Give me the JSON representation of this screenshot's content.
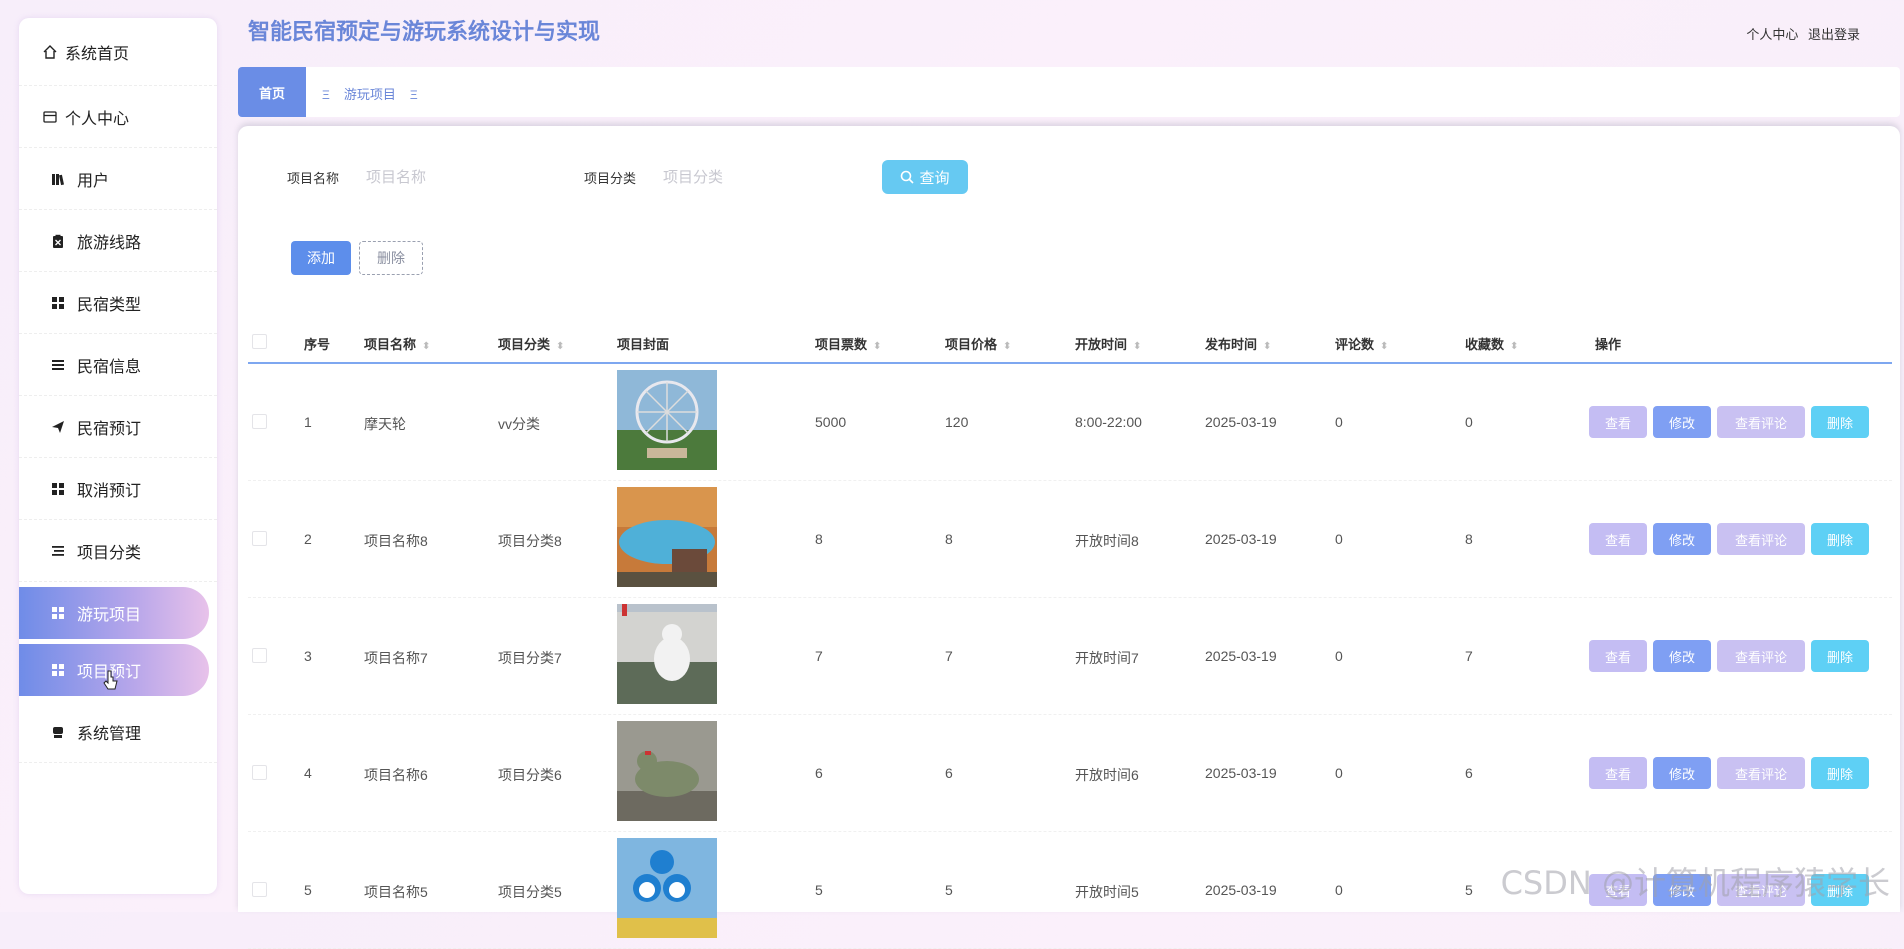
{
  "app_title": "智能民宿预定与游玩系统设计与实现",
  "header": {
    "profile": "个人中心",
    "logout": "退出登录"
  },
  "sidebar": {
    "items": [
      {
        "label": "系统首页",
        "icon": "home-icon"
      },
      {
        "label": "个人中心",
        "icon": "card-icon"
      },
      {
        "label": "用户",
        "icon": "books-icon"
      },
      {
        "label": "旅游线路",
        "icon": "clipboard-icon"
      },
      {
        "label": "民宿类型",
        "icon": "grid-icon"
      },
      {
        "label": "民宿信息",
        "icon": "list-icon"
      },
      {
        "label": "民宿预订",
        "icon": "send-icon"
      },
      {
        "label": "取消预订",
        "icon": "grid-icon"
      },
      {
        "label": "项目分类",
        "icon": "list-icon"
      },
      {
        "label": "游玩项目",
        "icon": "grid-icon",
        "active": true
      },
      {
        "label": "项目预订",
        "icon": "grid-icon",
        "active": true
      },
      {
        "label": "系统管理",
        "icon": "printer-icon"
      }
    ]
  },
  "tabs": {
    "home": "首页",
    "current": "游玩项目",
    "icon_glyph": "Ξ"
  },
  "search": {
    "name_label": "项目名称",
    "name_placeholder": "项目名称",
    "category_label": "项目分类",
    "category_placeholder": "项目分类",
    "query_button": "查询"
  },
  "actions": {
    "add": "添加",
    "delete": "删除"
  },
  "table": {
    "headers": [
      "序号",
      "项目名称",
      "项目分类",
      "项目封面",
      "项目票数",
      "项目价格",
      "开放时间",
      "发布时间",
      "评论数",
      "收藏数",
      "操作"
    ],
    "op_labels": {
      "view": "查看",
      "edit": "修改",
      "comments": "查看评论",
      "delete": "删除"
    },
    "rows": [
      {
        "no": "1",
        "name": "摩天轮",
        "category": "vv分类",
        "tickets": "5000",
        "price": "120",
        "open": "8:00-22:00",
        "date": "2025-03-19",
        "comments": "0",
        "favs": "0"
      },
      {
        "no": "2",
        "name": "项目名称8",
        "category": "项目分类8",
        "tickets": "8",
        "price": "8",
        "open": "开放时间8",
        "date": "2025-03-19",
        "comments": "0",
        "favs": "8"
      },
      {
        "no": "3",
        "name": "项目名称7",
        "category": "项目分类7",
        "tickets": "7",
        "price": "7",
        "open": "开放时间7",
        "date": "2025-03-19",
        "comments": "0",
        "favs": "7"
      },
      {
        "no": "4",
        "name": "项目名称6",
        "category": "项目分类6",
        "tickets": "6",
        "price": "6",
        "open": "开放时间6",
        "date": "2025-03-19",
        "comments": "0",
        "favs": "6"
      },
      {
        "no": "5",
        "name": "项目名称5",
        "category": "项目分类5",
        "tickets": "5",
        "price": "5",
        "open": "开放时间5",
        "date": "2025-03-19",
        "comments": "0",
        "favs": "5"
      }
    ]
  },
  "watermark": "CSDN @计算机程序猿学长"
}
